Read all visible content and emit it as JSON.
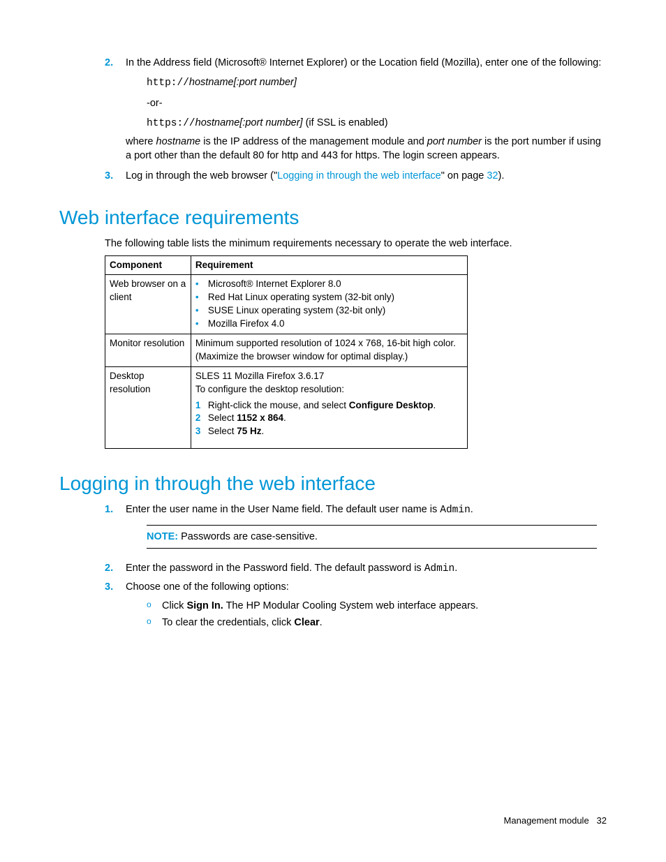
{
  "step2": {
    "num": "2.",
    "text": "In the Address field (Microsoft® Internet Explorer) or the Location field (Mozilla), enter one of the following:",
    "code1_scheme": "http://",
    "code1_host": "hostname[:port number]",
    "or": "-or-",
    "code2_scheme": "https://",
    "code2_host": "hostname[:port number]",
    "code2_tail": " (if SSL is enabled)",
    "where_pre": "where ",
    "where_hn": "hostname",
    "where_mid": " is the IP address of the management module and ",
    "where_pn": "port number",
    "where_post": " is the port number if using a port other than the default 80 for http and 443 for https. The login screen appears."
  },
  "step3": {
    "num": "3.",
    "pre": "Log in through the web browser (\"",
    "link": "Logging in through the web interface",
    "mid": "\" on page ",
    "page": "32",
    "post": ")."
  },
  "h2a": "Web interface requirements",
  "intro_a": "The following table lists the minimum requirements necessary to operate the web interface.",
  "table": {
    "h1": "Component",
    "h2": "Requirement",
    "r1c1": "Web browser on a client",
    "r1_items": [
      "Microsoft® Internet Explorer 8.0",
      "Red Hat Linux operating system (32-bit only)",
      "SUSE Linux operating system (32-bit only)",
      "Mozilla Firefox 4.0"
    ],
    "r2c1": "Monitor resolution",
    "r2c2": "Minimum supported resolution of 1024 x 768, 16-bit high color. (Maximize the browser window for optimal display.)",
    "r3c1": "Desktop resolution",
    "r3_l1": "SLES 11 Mozilla Firefox 3.6.17",
    "r3_l2": "To configure the desktop resolution:",
    "r3_s1a": "Right-click the mouse, and select ",
    "r3_s1b": "Configure Desktop",
    "r3_s1c": ".",
    "r3_s2a": "Select ",
    "r3_s2b": "1152 x 864",
    "r3_s2c": ".",
    "r3_s3a": "Select ",
    "r3_s3b": "75 Hz",
    "r3_s3c": "."
  },
  "h2b": "Logging in through the web interface",
  "login": {
    "s1n": "1.",
    "s1a": "Enter the user name in the User Name field. The default user name is ",
    "s1b": "Admin",
    "s1c": ".",
    "note_label": "NOTE:",
    "note_text": "  Passwords are case-sensitive.",
    "s2n": "2.",
    "s2a": "Enter the password in the Password field. The default password is ",
    "s2b": "Admin",
    "s2c": ".",
    "s3n": "3.",
    "s3": "Choose one of the following options:",
    "o1a": "Click ",
    "o1b": "Sign In.",
    "o1c": " The HP Modular Cooling System web interface appears.",
    "o2a": "To clear the credentials, click ",
    "o2b": "Clear",
    "o2c": "."
  },
  "footer": {
    "label": "Management module",
    "page": "32"
  }
}
